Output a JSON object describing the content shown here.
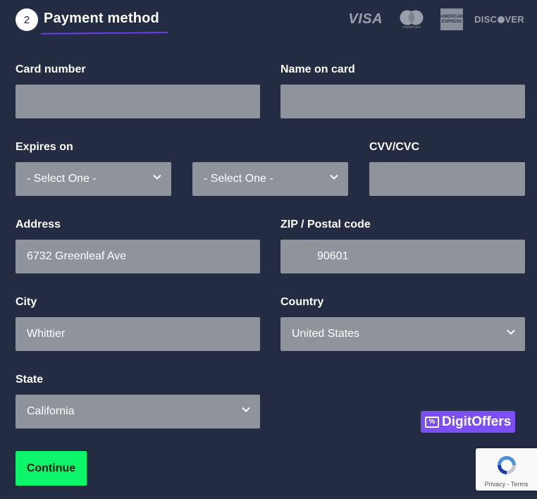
{
  "header": {
    "step_number": "2",
    "title": "Payment method",
    "card_brands": {
      "visa": "VISA",
      "mastercard": "mastercard",
      "amex_line1": "AMERICAN",
      "amex_line2": "EXPRESS",
      "discover_prefix": "DISC",
      "discover_suffix": "VER"
    }
  },
  "form": {
    "card_number": {
      "label": "Card number",
      "value": ""
    },
    "name_on_card": {
      "label": "Name on card",
      "value": ""
    },
    "expires_on": {
      "label": "Expires on",
      "month": "- Select One -",
      "year": "- Select One -"
    },
    "cvv": {
      "label": "CVV/CVC",
      "value": ""
    },
    "address": {
      "label": "Address",
      "value": "6732 Greenleaf Ave"
    },
    "zip": {
      "label": "ZIP / Postal code",
      "value": "90601"
    },
    "city": {
      "label": "City",
      "value": "Whittier"
    },
    "country": {
      "label": "Country",
      "value": "United States"
    },
    "state": {
      "label": "State",
      "value": "California"
    },
    "continue_label": "Continue"
  },
  "badges": {
    "digitoffers": "DigitOffers",
    "recaptcha_links": "Privacy - Terms"
  },
  "colors": {
    "background": "#232c42",
    "field_bg": "#8e939c",
    "accent_underline": "#6b3cf0",
    "continue_bg": "#0df56a",
    "digitoffers_bg": "#7b4ff5"
  }
}
